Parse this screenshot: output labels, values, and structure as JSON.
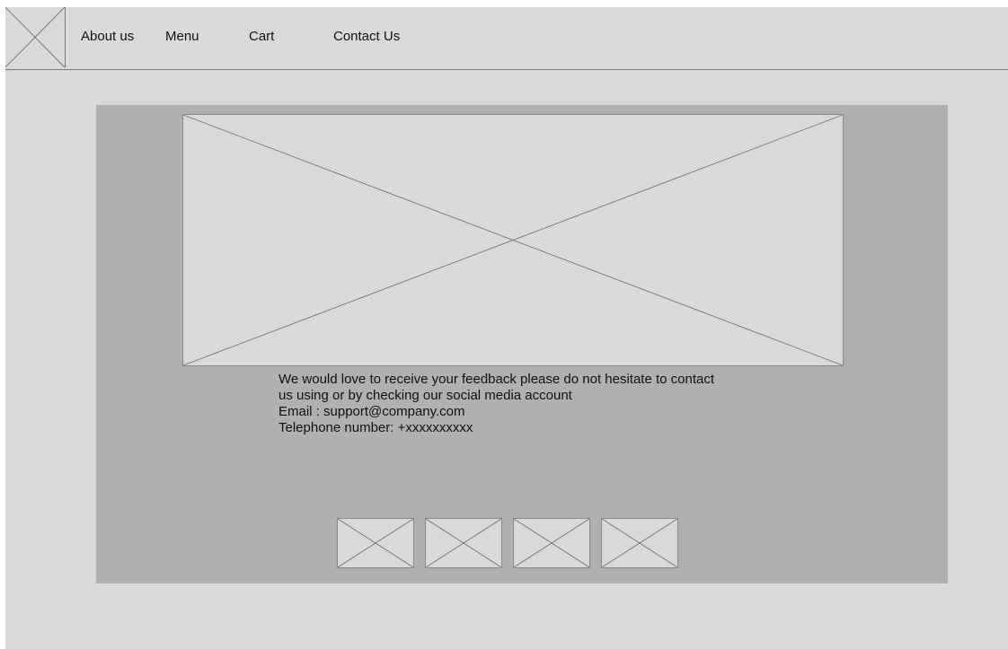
{
  "header": {
    "logo_icon": "placeholder-logo-icon",
    "nav": [
      {
        "label": "About us"
      },
      {
        "label": "Menu"
      },
      {
        "label": "Cart"
      },
      {
        "label": "Contact Us"
      }
    ]
  },
  "main": {
    "hero_icon": "image-placeholder-icon",
    "contact": {
      "line1": "We would love to receive your feedback please do not hesitate to contact",
      "line2": "us using or by checking our social media account",
      "email": "Email : support@company.com",
      "phone": "Telephone number:  +xxxxxxxxxx"
    },
    "social_icons": [
      {
        "icon": "social-media-placeholder-icon"
      },
      {
        "icon": "social-media-placeholder-icon"
      },
      {
        "icon": "social-media-placeholder-icon"
      },
      {
        "icon": "social-media-placeholder-icon"
      }
    ]
  },
  "colors": {
    "page_background": "#d9d9d9",
    "content_panel": "#b0b0b0",
    "placeholder_fill": "#d9d9d9",
    "placeholder_stroke": "#6a6a6a",
    "text": "#111111"
  }
}
